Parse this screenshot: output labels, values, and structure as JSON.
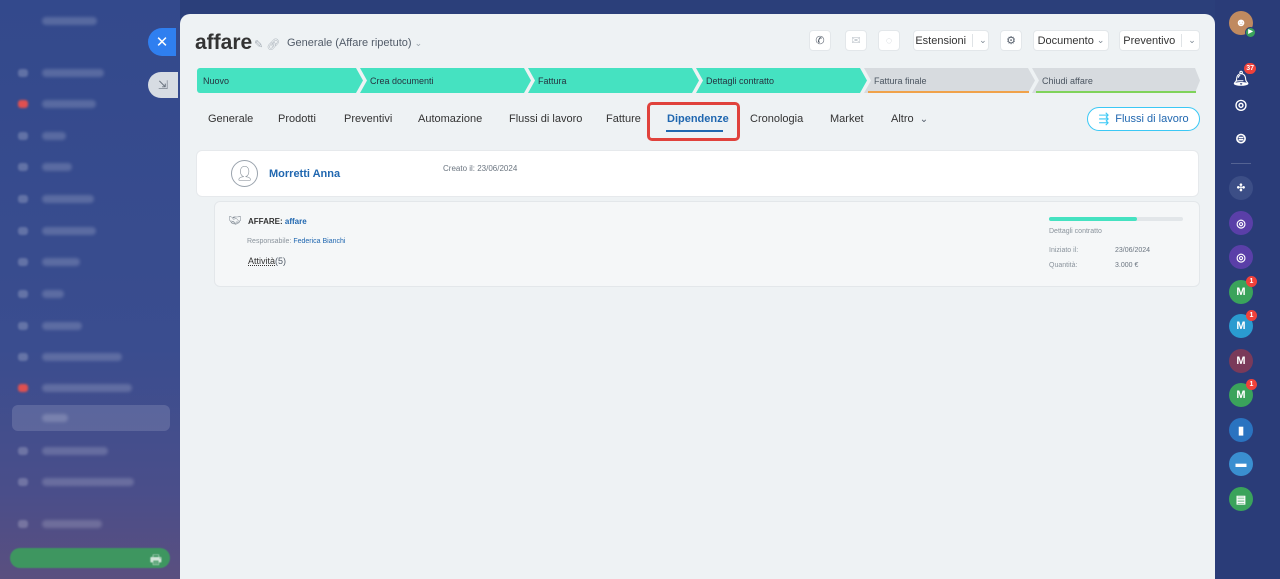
{
  "deal": {
    "title": "affare",
    "pipeline": "Generale (Affare ripetuto)"
  },
  "toolbar": {
    "extensions": "Estensioni",
    "document": "Documento",
    "quote": "Preventivo"
  },
  "stages": [
    {
      "label": "Nuovo",
      "status": "done"
    },
    {
      "label": "Crea documenti",
      "status": "done"
    },
    {
      "label": "Fattura",
      "status": "done"
    },
    {
      "label": "Dettagli contratto",
      "status": "done"
    },
    {
      "label": "Fattura finale",
      "status": "todo"
    },
    {
      "label": "Chiudi affare",
      "status": "todo"
    }
  ],
  "tabs": [
    "Generale",
    "Prodotti",
    "Preventivi",
    "Automazione",
    "Flussi di lavoro",
    "Fatture",
    "Dipendenze",
    "Cronologia",
    "Market",
    "Altro"
  ],
  "active_tab": "Dipendenze",
  "flow_button": "Flussi di lavoro",
  "contact": {
    "name": "Morretti Anna",
    "created": "Creato il: 23/06/2024"
  },
  "related": {
    "type_label": "AFFARE:",
    "name": "affare",
    "responsible_label": "Responsabile:",
    "responsible": "Federica Bianchi",
    "activities_label": "Attività",
    "activities_count": "(5)",
    "stage": "Dettagli contratto",
    "progress": 0.66,
    "started_label": "Iniziato il:",
    "started": "23/06/2024",
    "amount_label": "Quantità:",
    "amount": "3.000 €"
  },
  "right_bar": {
    "notifications_badge": "37",
    "chats": [
      {
        "letter": "M",
        "badge": "1",
        "color": "#3aa35b"
      },
      {
        "letter": "M",
        "badge": "1",
        "color": "#2a9bd0"
      },
      {
        "letter": "M",
        "badge": "",
        "color": "#7a3a5a"
      },
      {
        "letter": "M",
        "badge": "1",
        "color": "#3aa35b"
      }
    ]
  },
  "colors": {
    "stage_done": "#45e2c1",
    "stage_todo": "#d7dbdf",
    "accent": "#2067b0",
    "highlight": "#e0423c"
  }
}
